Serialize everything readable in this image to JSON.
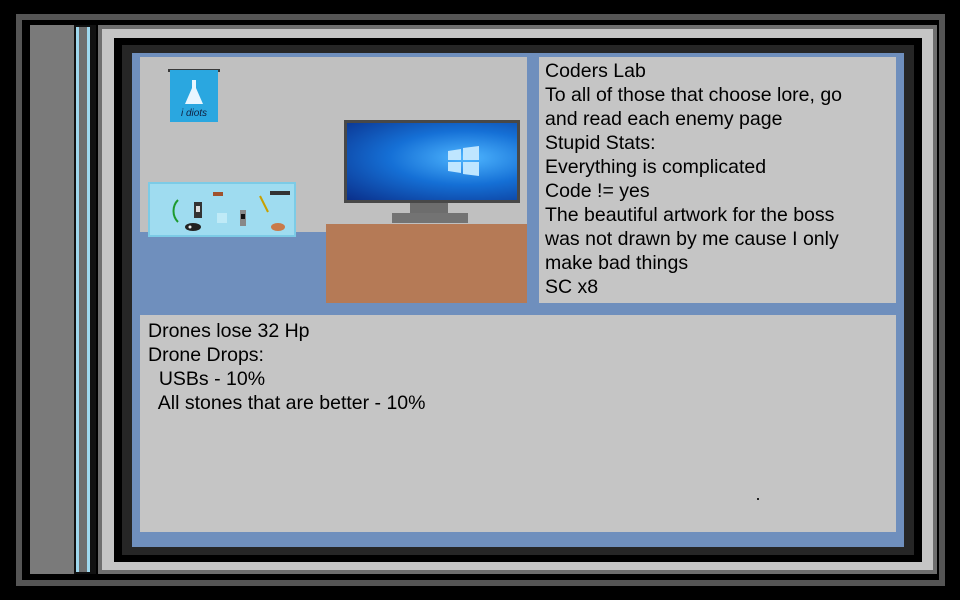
{
  "scene": {
    "poster_text": "i diots"
  },
  "lore_lines": [
    "Coders Lab",
    "To all of those that choose lore, go",
    "and read each enemy page",
    "Stupid Stats:",
    "Everything is complicated",
    "Code != yes",
    "The beautiful artwork for the boss",
    "was not drawn by me cause I only",
    "make bad things",
    "SC x8"
  ],
  "info_lines": [
    "Drones lose 32 Hp",
    "Drone Drops:",
    "  USBs - 10%",
    "  All stones that are better - 10%"
  ],
  "colors": {
    "panel_blue": "#6f8fbd",
    "text_box": "#c5c5c5",
    "desk": "#b57a56",
    "poster": "#2aa7e0",
    "pegboard": "#9fdcf0"
  }
}
